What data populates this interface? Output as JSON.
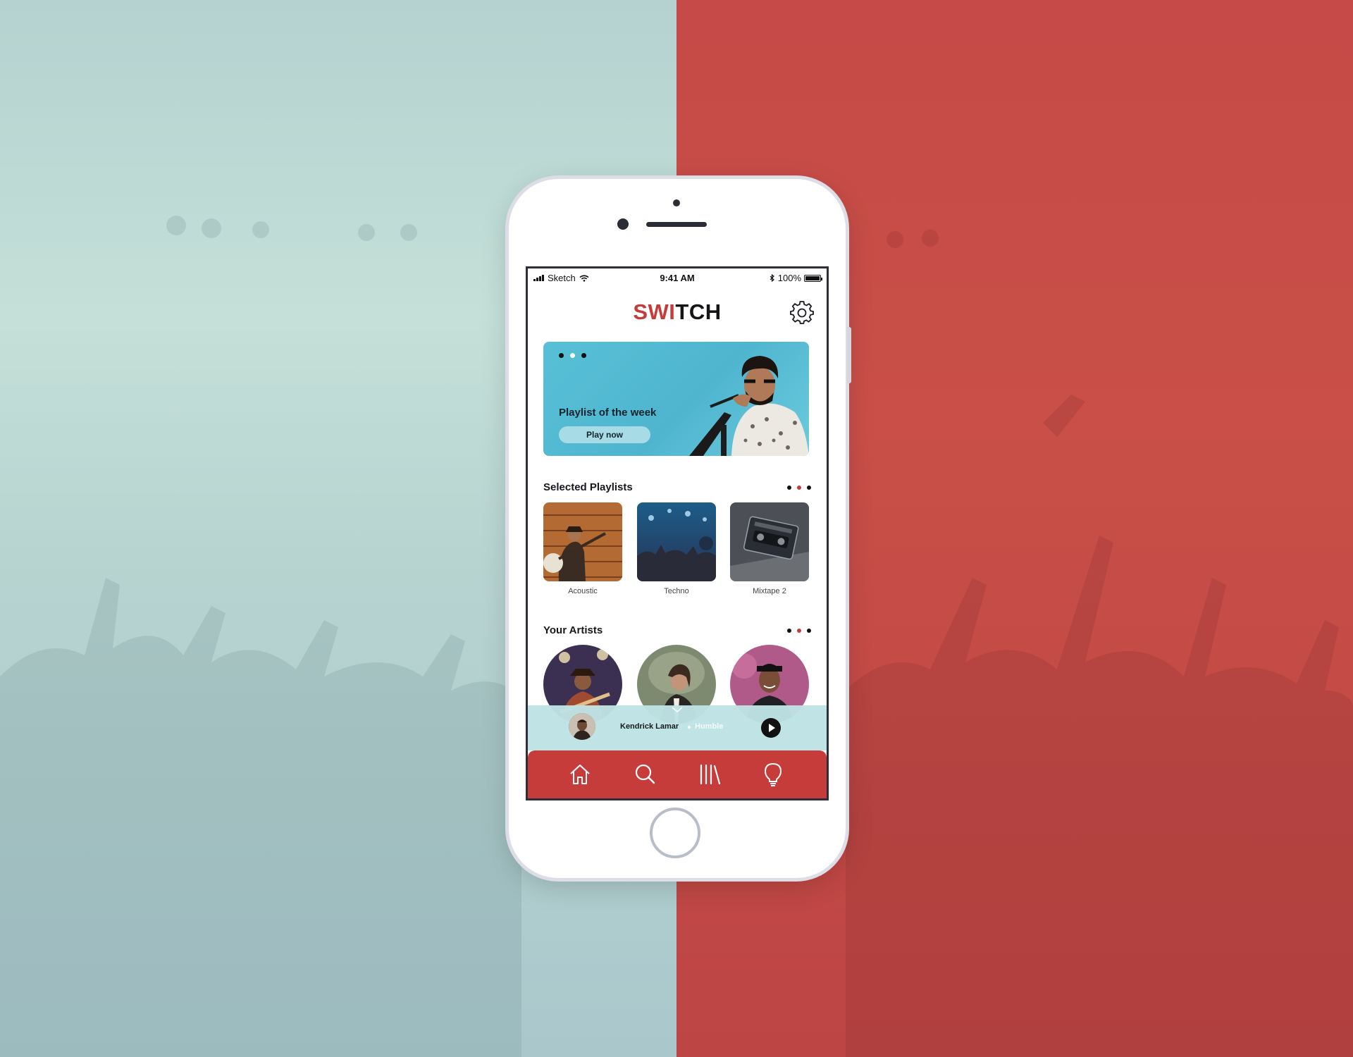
{
  "colors": {
    "accent": "#c63c3a",
    "teal": "#57c0d6",
    "background_left": "#b5d2d0",
    "background_right": "#c64a47"
  },
  "status_bar": {
    "carrier": "Sketch",
    "time": "9:41 AM",
    "battery": "100%",
    "battery_level": 1.0,
    "icons": [
      "signal-icon",
      "wifi-icon",
      "bluetooth-icon",
      "battery-icon"
    ]
  },
  "header": {
    "brand_red": "SWI",
    "brand_dark": "TCH",
    "settings_icon": "gear-icon"
  },
  "hero": {
    "title": "Playlist of the week",
    "button": "Play now",
    "active_dot": 1,
    "dot_count": 3
  },
  "selected_playlists": {
    "title": "Selected Playlists",
    "active_dot": 1,
    "items": [
      {
        "label": "Acoustic"
      },
      {
        "label": "Techno"
      },
      {
        "label": "Mixtape 2"
      }
    ]
  },
  "your_artists": {
    "title": "Your Artists",
    "active_dot": 1
  },
  "mini_player": {
    "artist": "Kendrick Lamar",
    "track": "Humble",
    "icons": [
      "chevron-down-icon",
      "play-icon"
    ]
  },
  "tab_bar": {
    "items": [
      "home-icon",
      "search-icon",
      "library-icon",
      "lightbulb-icon"
    ]
  }
}
